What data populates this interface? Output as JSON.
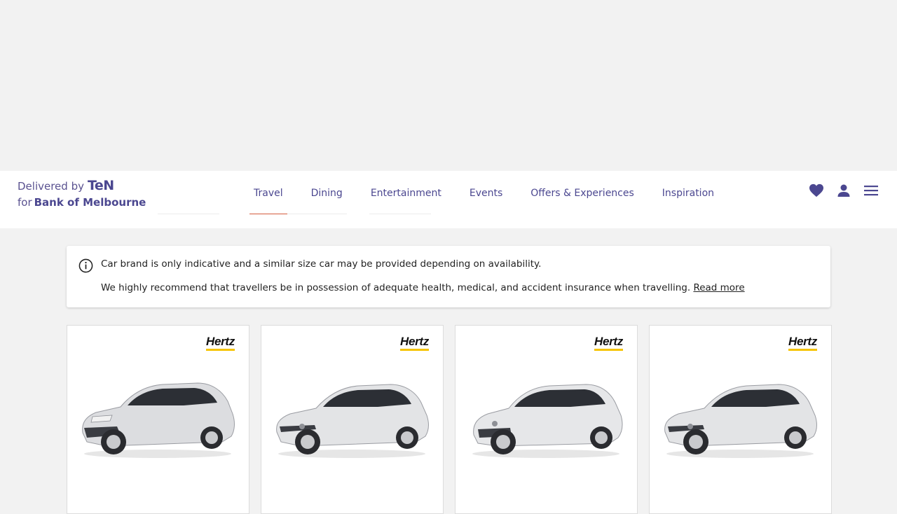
{
  "header": {
    "delivered_by": "Delivered by",
    "ten_logo": "TeN",
    "for_text": "for",
    "bank_name": "Bank of Melbourne",
    "nav": [
      {
        "label": "Travel",
        "active": true
      },
      {
        "label": "Dining",
        "active": false
      },
      {
        "label": "Entertainment",
        "active": false
      },
      {
        "label": "Events",
        "active": false
      },
      {
        "label": "Offers & Experiences",
        "active": false
      },
      {
        "label": "Inspiration",
        "active": false
      }
    ],
    "icons": [
      "heart-icon",
      "user-icon",
      "menu-icon"
    ],
    "accent_color": "#4b4790",
    "active_underline_color": "#d35b3c"
  },
  "notice": {
    "line1": "Car brand is only indicative and a similar size car may be provided depending on availability.",
    "line2": "We highly recommend that travellers be in possession of adequate health, medical, and accident insurance when travelling.",
    "read_more": "Read more"
  },
  "cards": [
    {
      "brand": "Hertz",
      "car_icon": "car-image-hatchback"
    },
    {
      "brand": "Hertz",
      "car_icon": "car-image-hatchback"
    },
    {
      "brand": "Hertz",
      "car_icon": "car-image-hatchback"
    },
    {
      "brand": "Hertz",
      "car_icon": "car-image-hatchback"
    }
  ]
}
